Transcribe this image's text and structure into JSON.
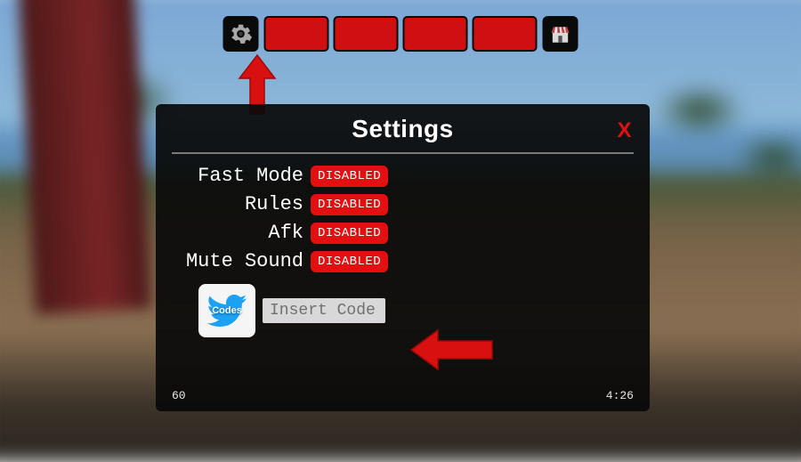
{
  "modal": {
    "title": "Settings",
    "close_label": "X",
    "rows": [
      {
        "label": "Fast Mode",
        "state": "DISABLED"
      },
      {
        "label": "Rules",
        "state": "DISABLED"
      },
      {
        "label": "Afk",
        "state": "DISABLED"
      },
      {
        "label": "Mute Sound",
        "state": "DISABLED"
      }
    ],
    "codes_button_label": "Codes",
    "code_placeholder": "Insert Code",
    "footer_left": "60",
    "footer_right": "4:26"
  },
  "colors": {
    "accent_red": "#e21010",
    "panel_black": "#0a0a0a",
    "twitter_blue": "#1da1f2"
  },
  "icons": {
    "gear": "gear-icon",
    "shop": "shop-icon",
    "twitter": "twitter-icon"
  }
}
